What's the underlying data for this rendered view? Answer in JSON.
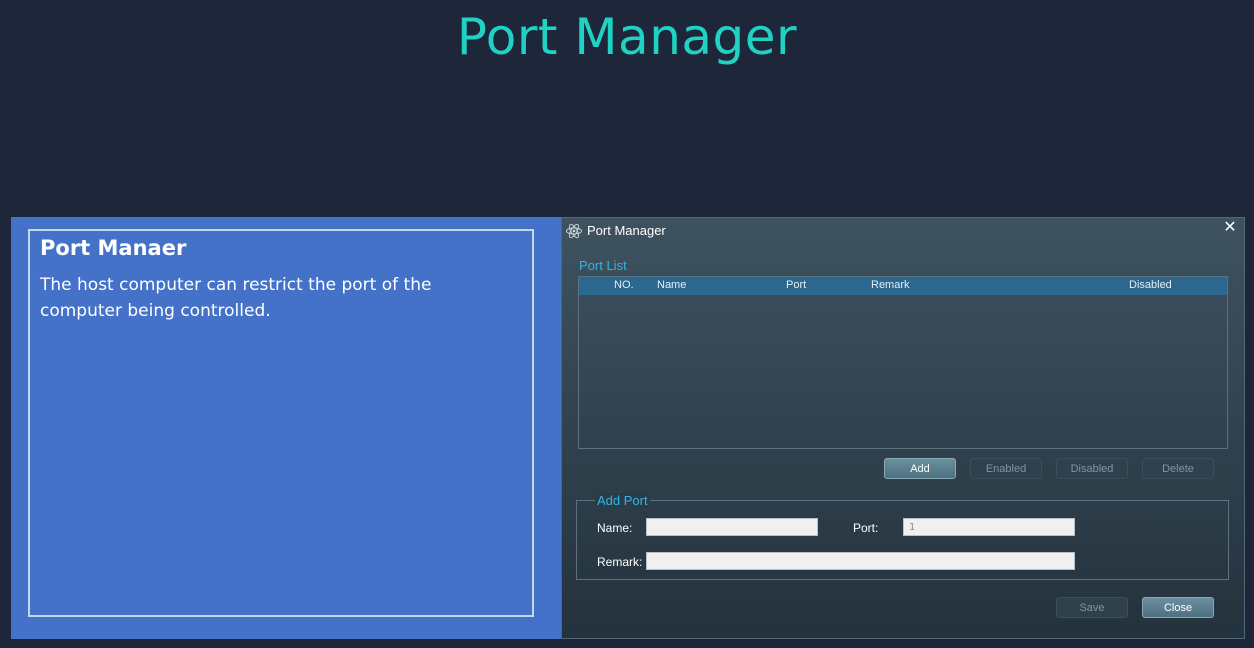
{
  "page": {
    "title": "Port Manager"
  },
  "info_panel": {
    "heading": "Port Manaer",
    "description": "The host computer can restrict the port of the computer being controlled."
  },
  "dialog": {
    "title": "Port Manager",
    "icon": "atom-icon",
    "close_icon": "close-icon",
    "port_list": {
      "label": "Port List",
      "columns": [
        "NO.",
        "Name",
        "Port",
        "Remark",
        "Disabled"
      ],
      "rows": []
    },
    "actions": {
      "add": "Add",
      "enabled": "Enabled",
      "disabled": "Disabled",
      "delete": "Delete"
    },
    "add_port": {
      "legend": "Add Port",
      "name_label": "Name:",
      "name_value": "",
      "port_label": "Port:",
      "port_value": "1",
      "remark_label": "Remark:",
      "remark_value": ""
    },
    "footer": {
      "save": "Save",
      "close": "Close"
    }
  },
  "colors": {
    "page_bg": "#1e273a",
    "title": "#1fd2c4",
    "info_panel_bg": "#4472c8",
    "section_label": "#2fb6e8",
    "table_header": "#2c6790"
  }
}
